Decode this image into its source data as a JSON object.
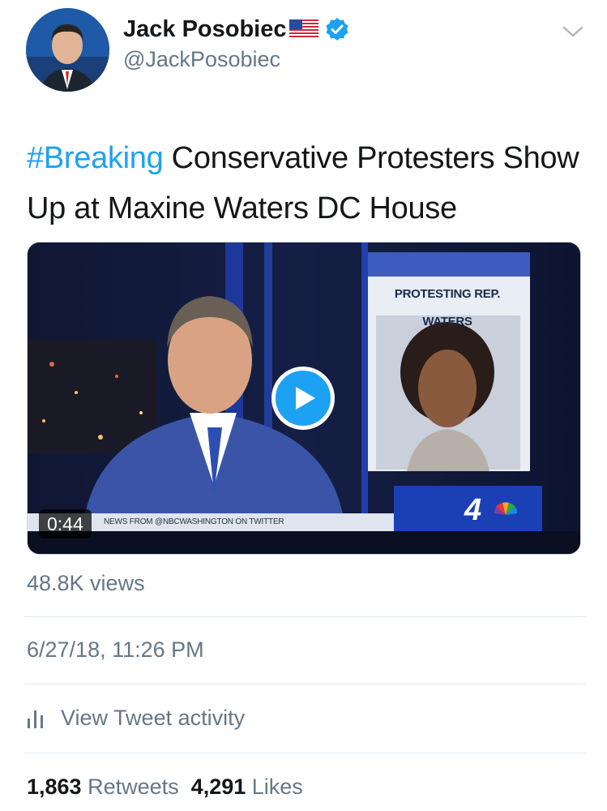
{
  "author": {
    "display_name": "Jack Posobiec",
    "handle": "@JackPosobiec",
    "flag_icon": "us-flag-emoji",
    "verified_icon": "verified-badge-icon"
  },
  "tweet": {
    "hashtag": "#Breaking",
    "text": " Conservative Protesters Show Up at Maxine Waters DC House"
  },
  "video": {
    "duration": "0:44",
    "chyron_title": "PROTESTING REP. WATERS",
    "ticker": "NEWS FROM @NBCWASHINGTON ON TWITTER",
    "channel_number": "4"
  },
  "stats": {
    "views": "48.8K views",
    "timestamp": "6/27/18, 11:26 PM",
    "activity_label": "View Tweet activity",
    "retweets_count": "1,863",
    "retweets_label": "Retweets",
    "likes_count": "4,291",
    "likes_label": "Likes"
  },
  "colors": {
    "link_blue": "#1da1f2",
    "secondary_text": "#657786",
    "primary_text": "#14171a",
    "divider": "#e1e8ed"
  }
}
